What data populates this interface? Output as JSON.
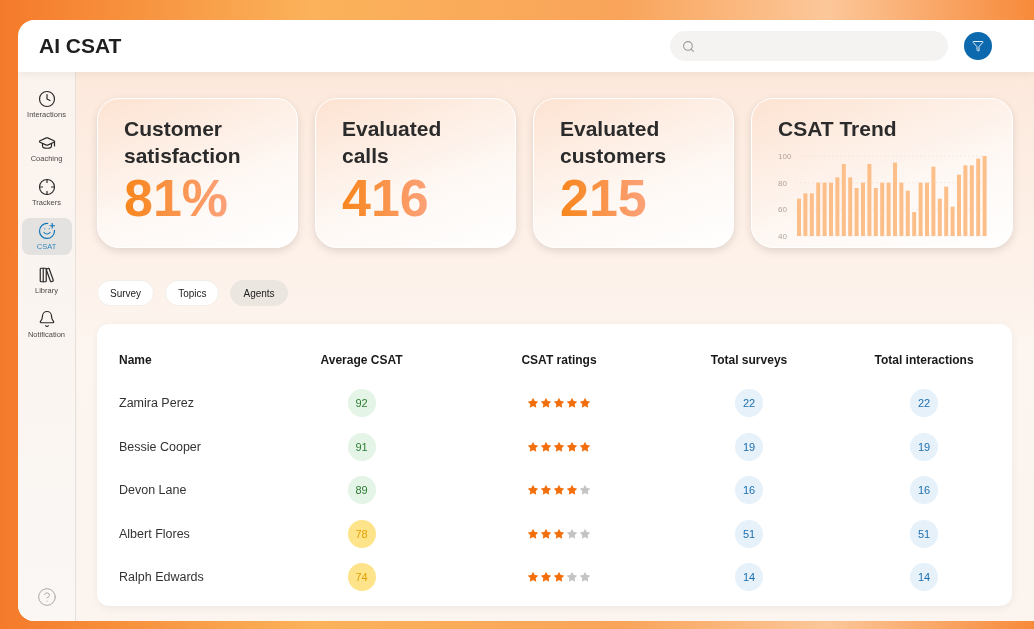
{
  "header": {
    "title": "AI CSAT"
  },
  "sidebar": {
    "items": [
      {
        "label": "Interactions",
        "kind": "clock",
        "selected": false
      },
      {
        "label": "Coaching",
        "kind": "cap",
        "selected": false
      },
      {
        "label": "Trackers",
        "kind": "target",
        "selected": false
      },
      {
        "label": "CSAT",
        "kind": "smile",
        "selected": true
      },
      {
        "label": "Library",
        "kind": "library",
        "selected": false
      },
      {
        "label": "Notification",
        "kind": "bell",
        "selected": false
      }
    ]
  },
  "stats": [
    {
      "label": "Customer satisfaction",
      "value": "81%"
    },
    {
      "label": "Evaluated calls",
      "value": "416"
    },
    {
      "label": "Evaluated customers",
      "value": "215"
    }
  ],
  "trend": {
    "title": "CSAT Trend",
    "chart_data": {
      "type": "bar",
      "values": [
        68,
        72,
        72,
        80,
        80,
        80,
        84,
        94,
        84,
        76,
        80,
        94,
        76,
        80,
        80,
        95,
        80,
        74,
        58,
        80,
        80,
        92,
        68,
        77,
        62,
        86,
        93,
        93,
        98,
        100
      ],
      "ylim": [
        40,
        100
      ],
      "yticks": [
        40,
        60,
        80,
        100
      ]
    }
  },
  "tabs": [
    {
      "label": "Survey",
      "selected": false
    },
    {
      "label": "Topics",
      "selected": false
    },
    {
      "label": "Agents",
      "selected": true
    }
  ],
  "table": {
    "columns": [
      "Name",
      "Average CSAT",
      "CSAT ratings",
      "Total surveys",
      "Total interactions"
    ],
    "rows": [
      {
        "name": "Zamira Perez",
        "avg": "92",
        "color": "#e4f4e6",
        "stars": 5,
        "surveys": "22",
        "interactions": "22"
      },
      {
        "name": "Bessie Cooper",
        "avg": "91",
        "color": "#e4f4e6",
        "stars": 5,
        "surveys": "19",
        "interactions": "19"
      },
      {
        "name": "Devon Lane",
        "avg": "89",
        "color": "#e4f4e6",
        "stars": 4,
        "surveys": "16",
        "interactions": "16"
      },
      {
        "name": "Albert Flores",
        "avg": "78",
        "color": "#fde48a",
        "stars": 3,
        "surveys": "51",
        "interactions": "51"
      },
      {
        "name": "Ralph Edwards",
        "avg": "74",
        "color": "#fde48a",
        "stars": 3,
        "surveys": "14",
        "interactions": "14"
      }
    ]
  }
}
